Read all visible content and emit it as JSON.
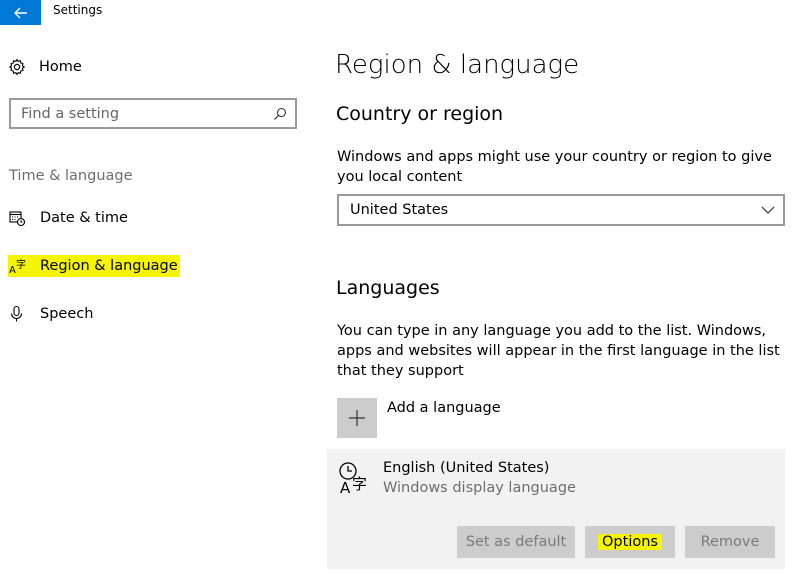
{
  "window": {
    "title": "Settings"
  },
  "sidebar": {
    "home_label": "Home",
    "search_placeholder": "Find a setting",
    "section_label": "Time & language",
    "items": [
      {
        "label": "Date & time",
        "icon": "calendar-clock-icon"
      },
      {
        "label": "Region & language",
        "icon": "language-icon",
        "active": true
      },
      {
        "label": "Speech",
        "icon": "microphone-icon"
      }
    ]
  },
  "main": {
    "title": "Region & language",
    "country": {
      "heading": "Country or region",
      "description": "Windows and apps might use your country or region to give you local content",
      "selected": "United States"
    },
    "languages": {
      "heading": "Languages",
      "description": "You can type in any language you add to the list. Windows, apps and websites will appear in the first language in the list that they support",
      "add_label": "Add a language",
      "entry": {
        "name": "English (United States)",
        "subtitle": "Windows display language"
      },
      "buttons": {
        "set_default": "Set as default",
        "options": "Options",
        "remove": "Remove"
      }
    }
  },
  "colors": {
    "accent": "#0078d7",
    "highlight": "#f5f500"
  }
}
